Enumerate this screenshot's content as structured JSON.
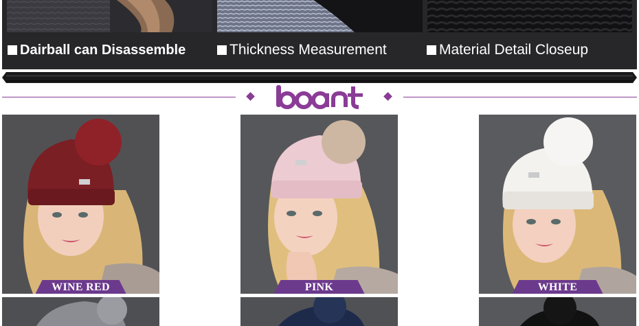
{
  "top_banner": {
    "captions": [
      {
        "text": "Dairball can Disassemble"
      },
      {
        "text": "Thickness Measurement"
      },
      {
        "text": "Material Detail Closeup"
      }
    ]
  },
  "brand": {
    "logo_text": "boant",
    "accent_color": "#8a3c96"
  },
  "products": [
    {
      "color_label": "WINE RED",
      "hat_color": "#7a1f24",
      "pompom_color": "#8f2228"
    },
    {
      "color_label": "PINK",
      "hat_color": "#edcbd2",
      "pompom_color": "#cdb7a2"
    },
    {
      "color_label": "WHITE",
      "hat_color": "#f4f2ef",
      "pompom_color": "#f6f5f3"
    }
  ],
  "partial_products": [
    {
      "hat_color": "#8b8d92"
    },
    {
      "hat_color": "#1d2a4a"
    },
    {
      "hat_color": "#111111"
    }
  ]
}
